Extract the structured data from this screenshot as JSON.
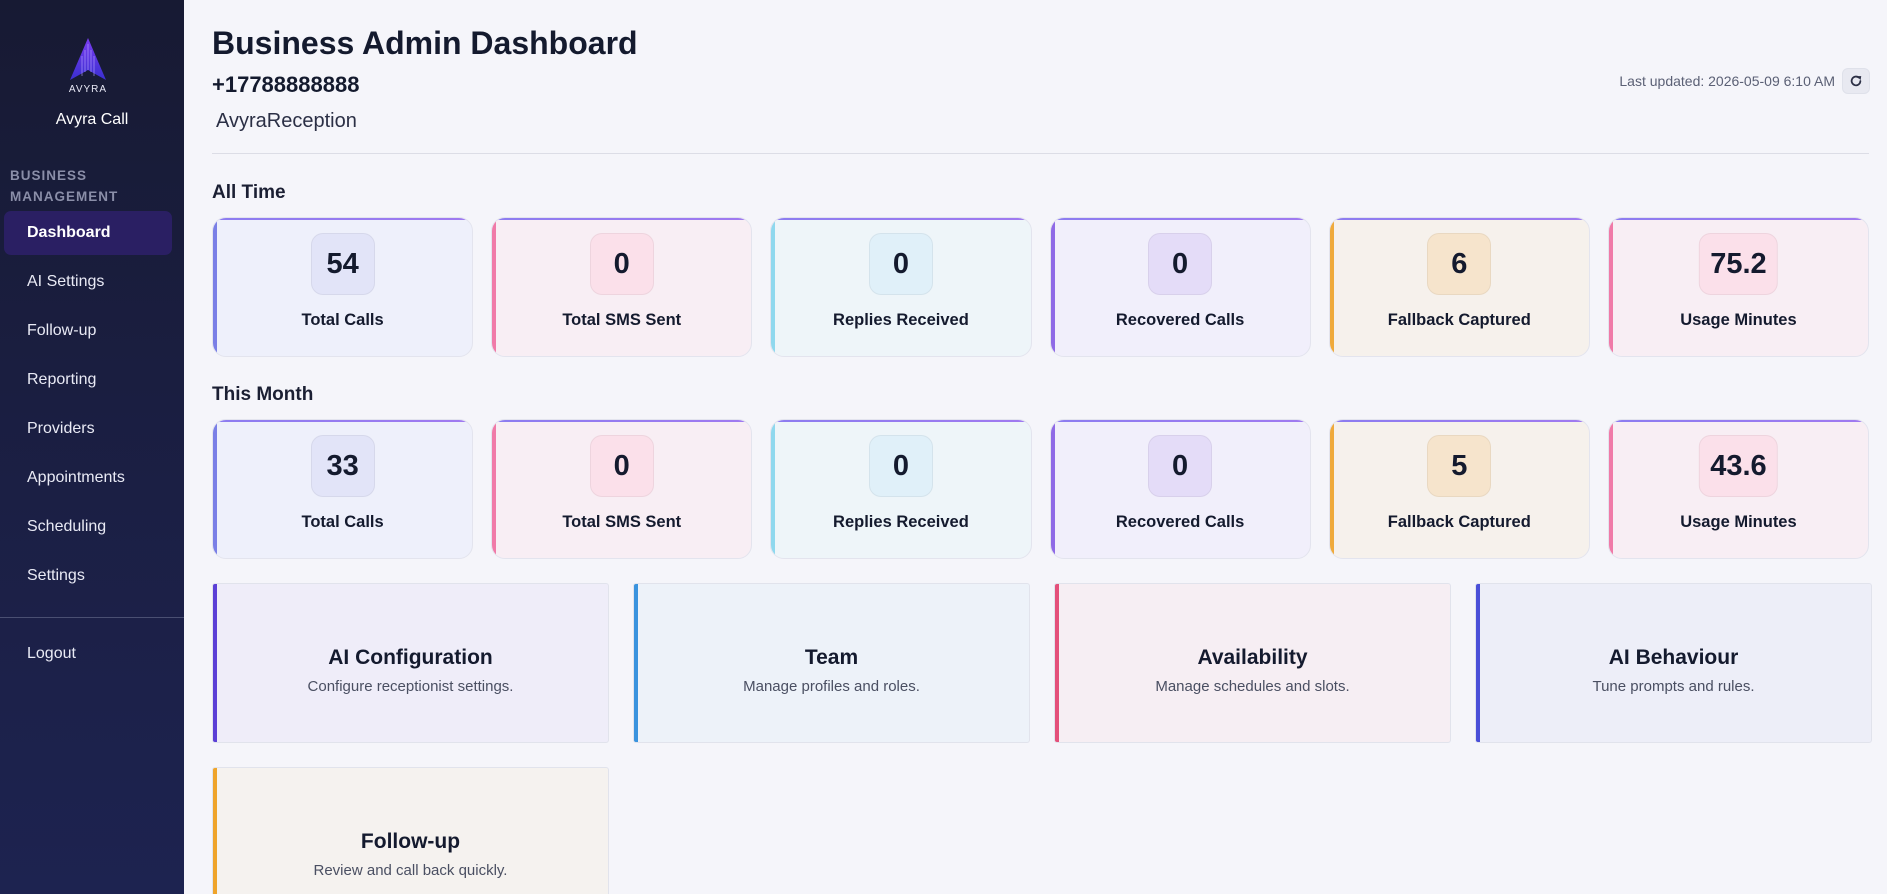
{
  "sidebar": {
    "logo_text": "AVYRA",
    "app_name": "Avyra Call",
    "section_label": "BUSINESS MANAGEMENT",
    "items": [
      {
        "label": "Dashboard",
        "active": true
      },
      {
        "label": "AI Settings"
      },
      {
        "label": "Follow-up"
      },
      {
        "label": "Reporting"
      },
      {
        "label": "Providers"
      },
      {
        "label": "Appointments"
      },
      {
        "label": "Scheduling"
      },
      {
        "label": "Settings"
      }
    ],
    "logout_label": "Logout"
  },
  "header": {
    "title": "Business Admin Dashboard",
    "phone": "+17788888888",
    "business_name": "AvyraReception",
    "last_updated": "Last updated: 2026-05-09 6:10 AM",
    "refresh_icon": "refresh-icon"
  },
  "all_time": {
    "title": "All Time",
    "stats": [
      {
        "value": "54",
        "label": "Total Calls"
      },
      {
        "value": "0",
        "label": "Total SMS Sent"
      },
      {
        "value": "0",
        "label": "Replies Received"
      },
      {
        "value": "0",
        "label": "Recovered Calls"
      },
      {
        "value": "6",
        "label": "Fallback Captured"
      },
      {
        "value": "75.2",
        "label": "Usage Minutes"
      }
    ]
  },
  "this_month": {
    "title": "This Month",
    "stats": [
      {
        "value": "33",
        "label": "Total Calls"
      },
      {
        "value": "0",
        "label": "Total SMS Sent"
      },
      {
        "value": "0",
        "label": "Replies Received"
      },
      {
        "value": "0",
        "label": "Recovered Calls"
      },
      {
        "value": "5",
        "label": "Fallback Captured"
      },
      {
        "value": "43.6",
        "label": "Usage Minutes"
      }
    ]
  },
  "actions": [
    {
      "title": "AI Configuration",
      "desc": "Configure receptionist settings."
    },
    {
      "title": "Team",
      "desc": "Manage profiles and roles."
    },
    {
      "title": "Availability",
      "desc": "Manage schedules and slots."
    },
    {
      "title": "AI Behaviour",
      "desc": "Tune prompts and rules."
    },
    {
      "title": "Follow-up",
      "desc": "Review and call back quickly."
    }
  ],
  "colors": {
    "sidebar_bg": "#171a33",
    "active_nav": "#2a1f63",
    "page_bg": "#f5f5fa"
  }
}
